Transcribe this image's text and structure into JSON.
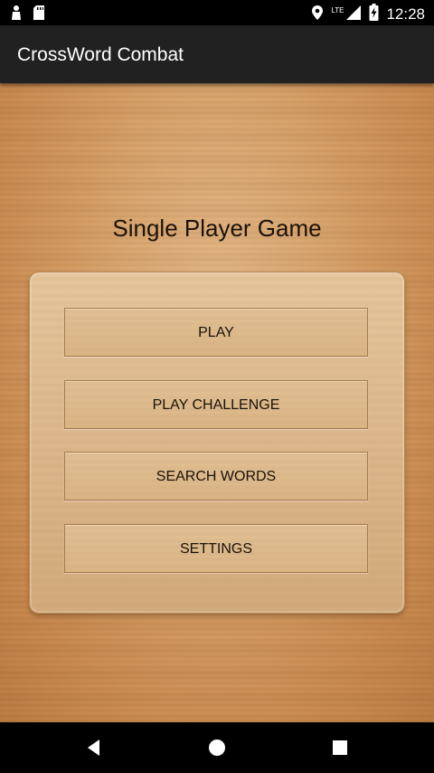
{
  "status_bar": {
    "time": "12:28",
    "network": "LTE",
    "icons": [
      "notification-icon",
      "sd-card-icon",
      "location-icon",
      "signal-icon",
      "battery-charging-icon"
    ]
  },
  "app_bar": {
    "title": "CrossWord Combat",
    "background_color": "#212121"
  },
  "main": {
    "title": "Single Player Game",
    "buttons": [
      {
        "label": "PLAY"
      },
      {
        "label": "PLAY CHALLENGE"
      },
      {
        "label": "SEARCH WORDS"
      },
      {
        "label": "SETTINGS"
      }
    ]
  },
  "nav_bar": {
    "icons": [
      "back-icon",
      "home-icon",
      "recents-icon"
    ]
  }
}
